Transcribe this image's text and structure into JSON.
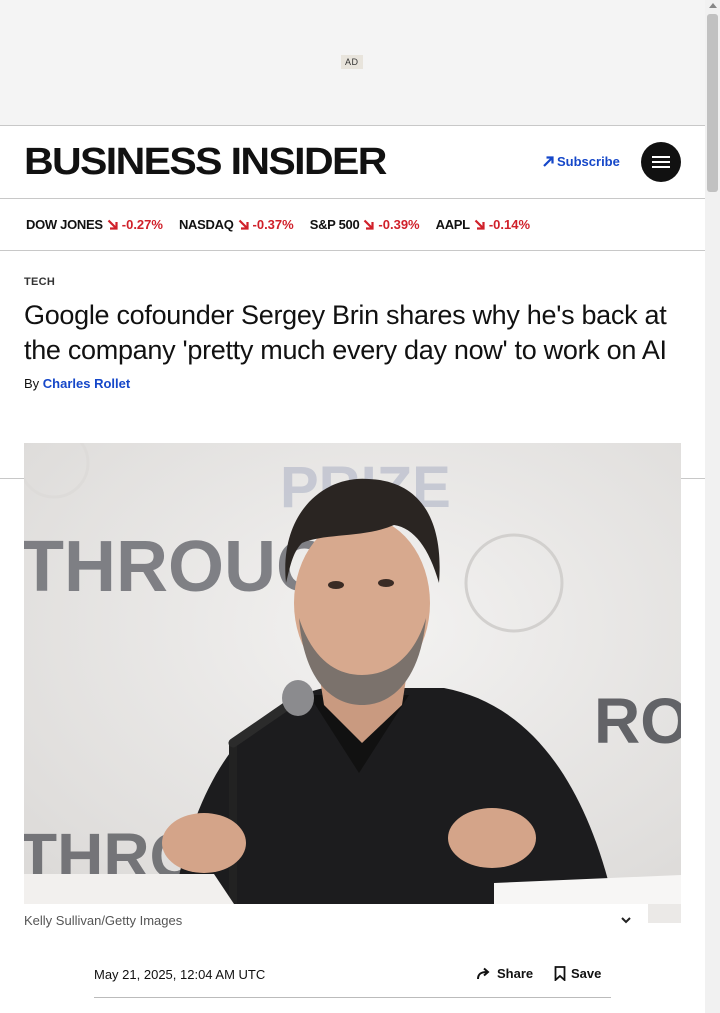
{
  "ad": {
    "label": "AD"
  },
  "header": {
    "logo_text": "BUSINESS INSIDER",
    "subscribe_label": "Subscribe",
    "accent_color": "#1547c9"
  },
  "ticker": [
    {
      "name": "DOW JONES",
      "change": "-0.27%"
    },
    {
      "name": "NASDAQ",
      "change": "-0.37%"
    },
    {
      "name": "S&P 500",
      "change": "-0.39%"
    },
    {
      "name": "AAPL",
      "change": "-0.14%"
    }
  ],
  "article": {
    "category": "TECH",
    "headline": "Google cofounder Sergey Brin shares why he's back at the company 'pretty much every day now' to work on AI",
    "byline_prefix": "By",
    "author": "Charles Rollet",
    "photo": {
      "backdrop_text_1": "THROUGH",
      "backdrop_text_2": "PRIZE",
      "backdrop_text_3": "THROUG",
      "backdrop_text_4": "ROU",
      "caption": "Kelly Sullivan/Getty Images"
    },
    "date": "May 21, 2025, 12:04 AM UTC",
    "share_label": "Share",
    "save_label": "Save"
  }
}
